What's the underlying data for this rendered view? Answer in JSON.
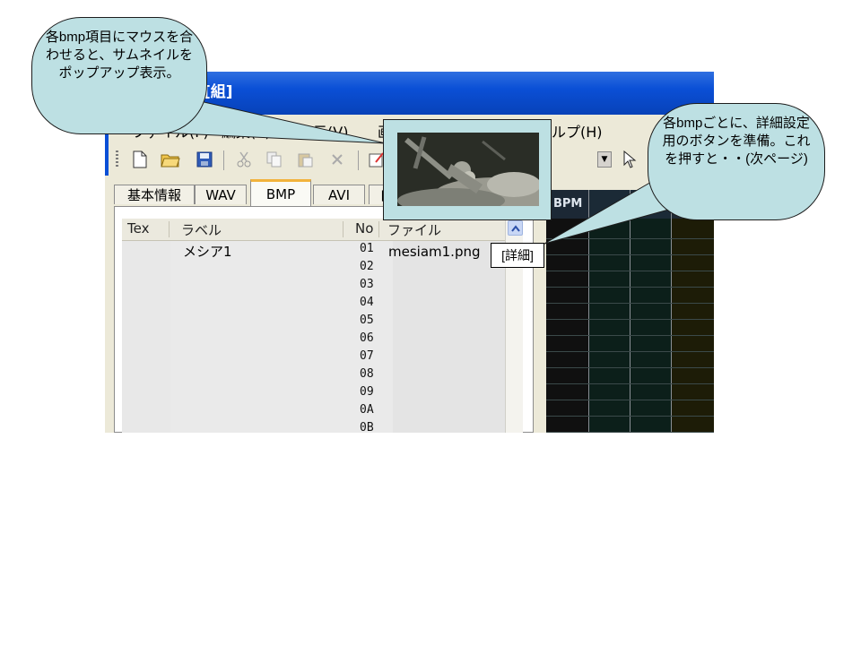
{
  "window": {
    "title_fragment": "[組]"
  },
  "menu": [
    {
      "label": "ファイル(F)"
    },
    {
      "label": "編集(E)"
    },
    {
      "label": "表示(V)"
    },
    {
      "label": "画"
    },
    {
      "label": "ルプ(H)"
    }
  ],
  "toolbar_icons": [
    "new-file-icon",
    "open-folder-icon",
    "save-icon",
    "cut-icon",
    "copy-icon",
    "paste-icon",
    "delete-icon",
    "edit-icon"
  ],
  "tabs": [
    "基本情報",
    "WAV",
    "BMP",
    "AVI",
    "自"
  ],
  "active_tab": "BMP",
  "grid": {
    "headers": {
      "tex": "Tex",
      "label": "ラベル",
      "no": "No",
      "file": "ファイル"
    },
    "rows": [
      {
        "no": "01",
        "label": "メシア1",
        "file": "mesiam1.png"
      },
      {
        "no": "02",
        "label": "",
        "file": ""
      },
      {
        "no": "03",
        "label": "",
        "file": ""
      },
      {
        "no": "04",
        "label": "",
        "file": ""
      },
      {
        "no": "05",
        "label": "",
        "file": ""
      },
      {
        "no": "06",
        "label": "",
        "file": ""
      },
      {
        "no": "07",
        "label": "",
        "file": ""
      },
      {
        "no": "08",
        "label": "",
        "file": ""
      },
      {
        "no": "09",
        "label": "",
        "file": ""
      },
      {
        "no": "0A",
        "label": "",
        "file": ""
      },
      {
        "no": "0B",
        "label": "",
        "file": ""
      }
    ]
  },
  "right_pane": {
    "header_bpm": "BPM"
  },
  "detail_button": {
    "label": "[詳細]"
  },
  "callouts": {
    "thumbnail": "各bmp項目にマウスを合わせると、サムネイルをポップアップ表示。",
    "detail": "各bmpごとに、詳細設定用のボタンを準備。これを押すと・・(次ページ)"
  },
  "colors": {
    "callout_fill": "#bde0e3",
    "titlebar": "#0a4fd6",
    "active_tab_accent": "#f2b33c"
  }
}
